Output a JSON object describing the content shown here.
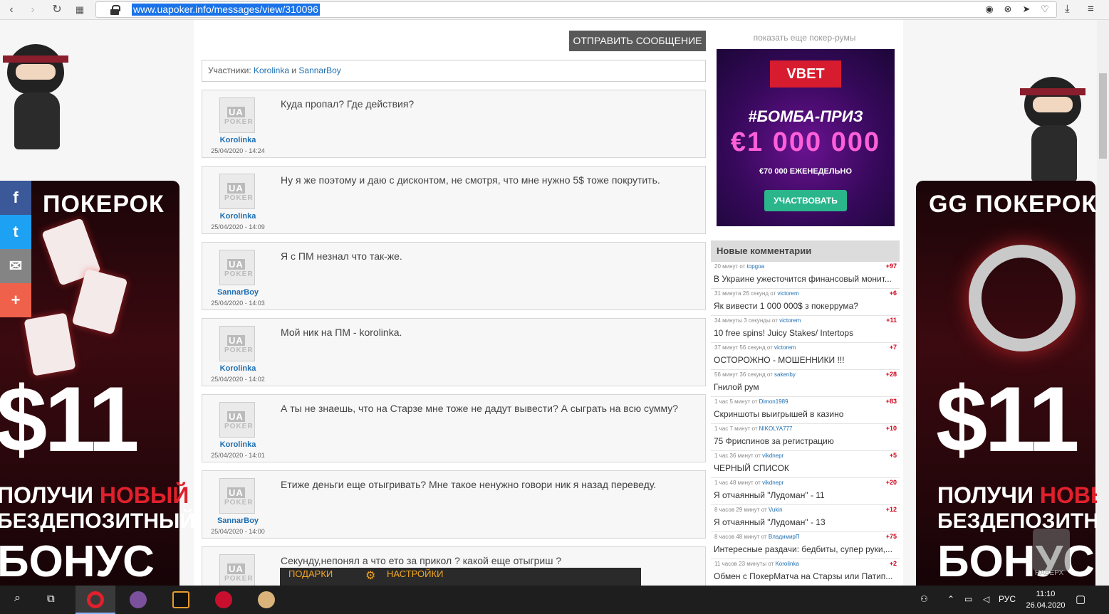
{
  "browser": {
    "url": "www.uapoker.info/messages/view/310096"
  },
  "left_ad": {
    "logo": "ПОКЕРОК",
    "amount": "$11",
    "line1_a": "ПОЛУЧИ ",
    "line1_b": "НОВЫЙ",
    "line2": "БЕЗДЕПОЗИТНЫЙ",
    "line3": "БОНУС"
  },
  "right_ad": {
    "logo": "GG ПОКЕРОК",
    "amount": "$11",
    "line1_a": "ПОЛУЧИ ",
    "line1_b": "НОВЫЙ",
    "line2": "БЕЗДЕПОЗИТНЫЙ",
    "line3": "БОНУС",
    "up_label": "НАВЕРХ"
  },
  "share": {
    "facebook": "f",
    "twitter": "t",
    "email": "✉",
    "more": "+"
  },
  "main": {
    "send_button": "ОТПРАВИТЬ СООБЩЕНИЕ",
    "participants_label": "Участники: ",
    "participant_1": "Korolinka",
    "participants_and": " и ",
    "participant_2": "SannarBoy",
    "messages": [
      {
        "author": "Korolinka",
        "date": "25/04/2020 - 14:24",
        "text": "Куда пропал? Где действия?"
      },
      {
        "author": "Korolinka",
        "date": "25/04/2020 - 14:09",
        "text": "Ну я же поэтому и даю с дисконтом, не смотря, что мне нужно 5$ тоже покрутить."
      },
      {
        "author": "SannarBoy",
        "date": "25/04/2020 - 14:03",
        "text": "Я с ПМ незнал что так-же."
      },
      {
        "author": "Korolinka",
        "date": "25/04/2020 - 14:02",
        "text": "Мой ник на ПМ - korolinka."
      },
      {
        "author": "Korolinka",
        "date": "25/04/2020 - 14:01",
        "text": "А ты не знаешь, что на Старзе мне тоже не дадут вывести? А сыграть на всю сумму?"
      },
      {
        "author": "SannarBoy",
        "date": "25/04/2020 - 14:00",
        "text": "Етиже деньги еще отыгривать? Мне такое ненужно говори ник я назад переведу."
      },
      {
        "author": "",
        "date": "",
        "text": "Секунду,непонял а что ето за прикол ? какой еще отыгриш ?"
      }
    ],
    "avatar_ua": "UA",
    "avatar_poker": "POKER",
    "bottom_gifts": "ПОДАРКИ",
    "bottom_settings": "НАСТРОЙКИ"
  },
  "sidebar": {
    "more_rooms": "показать еще покер-румы",
    "vbet": {
      "logo": "VBET",
      "tag": "#БОМБА-ПРИЗ",
      "sum": "€1 000 000",
      "weekly": "€70 000 ЕЖЕНЕДЕЛЬНО",
      "button": "УЧАСТВОВАТЬ"
    },
    "comments_title": "Новые комментарии",
    "comments": [
      {
        "time": "20 минут от ",
        "user": "topgoa",
        "score": "+97",
        "title": "В Украине ужесточится финансовый монит..."
      },
      {
        "time": "31 минута 26 секунд от ",
        "user": "victorem",
        "score": "+6",
        "title": "Як вивести 1 000 000$ з покеррума?"
      },
      {
        "time": "34 минуты 3 секунды от ",
        "user": "victorem",
        "score": "+11",
        "title": "10 free spins! Juicy Stakes/ Intertops"
      },
      {
        "time": "37 минут 56 секунд от ",
        "user": "victorem",
        "score": "+7",
        "title": "ОСТОРОЖНО - МОШЕННИКИ !!!"
      },
      {
        "time": "56 минут 36 секунд от ",
        "user": "sakenby",
        "score": "+28",
        "title": "Гнилой рум"
      },
      {
        "time": "1 час 5 минут от ",
        "user": "Dimon1989",
        "score": "+83",
        "title": "Скриншоты выигрышей в казино"
      },
      {
        "time": "1 час 7 минут от ",
        "user": "NIKOLYA777",
        "score": "+10",
        "title": "75 Фриспинов за регистрацию"
      },
      {
        "time": "1 час 36 минут от ",
        "user": "vikdnepr",
        "score": "+5",
        "title": "ЧЕРНЫЙ СПИСОК"
      },
      {
        "time": "1 час 48 минут от ",
        "user": "vikdnepr",
        "score": "+20",
        "title": "Я отчаянный \"Лудоман\" - 11"
      },
      {
        "time": "8 часов 29 минут от ",
        "user": "Vukin",
        "score": "+12",
        "title": "Я отчаянный \"Лудоман\" - 13"
      },
      {
        "time": "8 часов 48 минут от ",
        "user": "ВладимирП",
        "score": "+75",
        "title": "Интересные раздачи: бедбиты, супер руки,..."
      },
      {
        "time": "11 часов 23 минуты от ",
        "user": "Korolinka",
        "score": "+2",
        "title": "Обмен с ПокерМатча на Старзы или Патип..."
      }
    ]
  },
  "taskbar": {
    "lang": "РУС",
    "time": "11:10",
    "date": "26.04.2020"
  },
  "colors": {
    "link": "#1f6fb2",
    "send_button": "#595959",
    "accent_red": "#e0202c",
    "vbet_button": "#2ab58a"
  }
}
